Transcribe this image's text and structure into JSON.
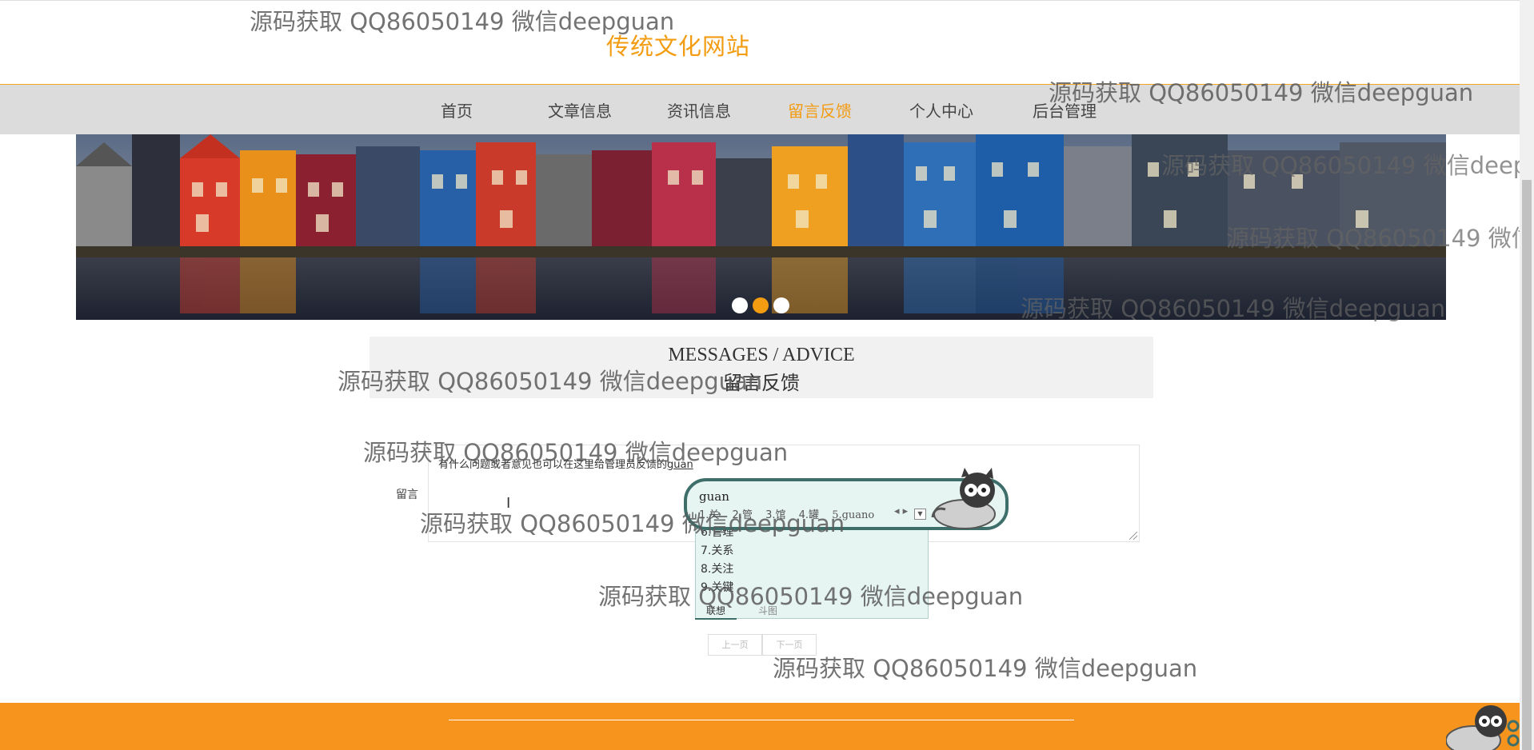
{
  "header": {
    "site_title": "传统文化网站"
  },
  "nav": {
    "items": [
      {
        "label": "首页"
      },
      {
        "label": "文章信息"
      },
      {
        "label": "资讯信息"
      },
      {
        "label": "留言反馈"
      },
      {
        "label": "个人中心"
      },
      {
        "label": "后台管理"
      }
    ],
    "active_label": "留言反馈",
    "accent_color": "#f39c12"
  },
  "banner": {
    "active_dot_index": 1
  },
  "section": {
    "title_en": "MESSAGES / ADVICE",
    "title_cn": "留言反馈"
  },
  "form": {
    "label": "留言",
    "message_prefix": "有什么问题或者意见也可以在这里给管理员反馈的",
    "message_typed": "guan"
  },
  "ime": {
    "input": "guan",
    "candidates": [
      "1.关",
      "2.管",
      "3.馆",
      "4.罐",
      "5.guano"
    ],
    "list": [
      "6.管理",
      "7.关系",
      "8.关注",
      "9.关键"
    ],
    "tabs": [
      "联想",
      "斗图"
    ]
  },
  "pager": {
    "prev": "上一页",
    "next": "下一页"
  },
  "watermark": "源码获取 QQ86050149 微信deepguan",
  "colors": {
    "footer": "#f7941d",
    "accent": "#f39c12",
    "ime_border": "#3e6e6a"
  }
}
